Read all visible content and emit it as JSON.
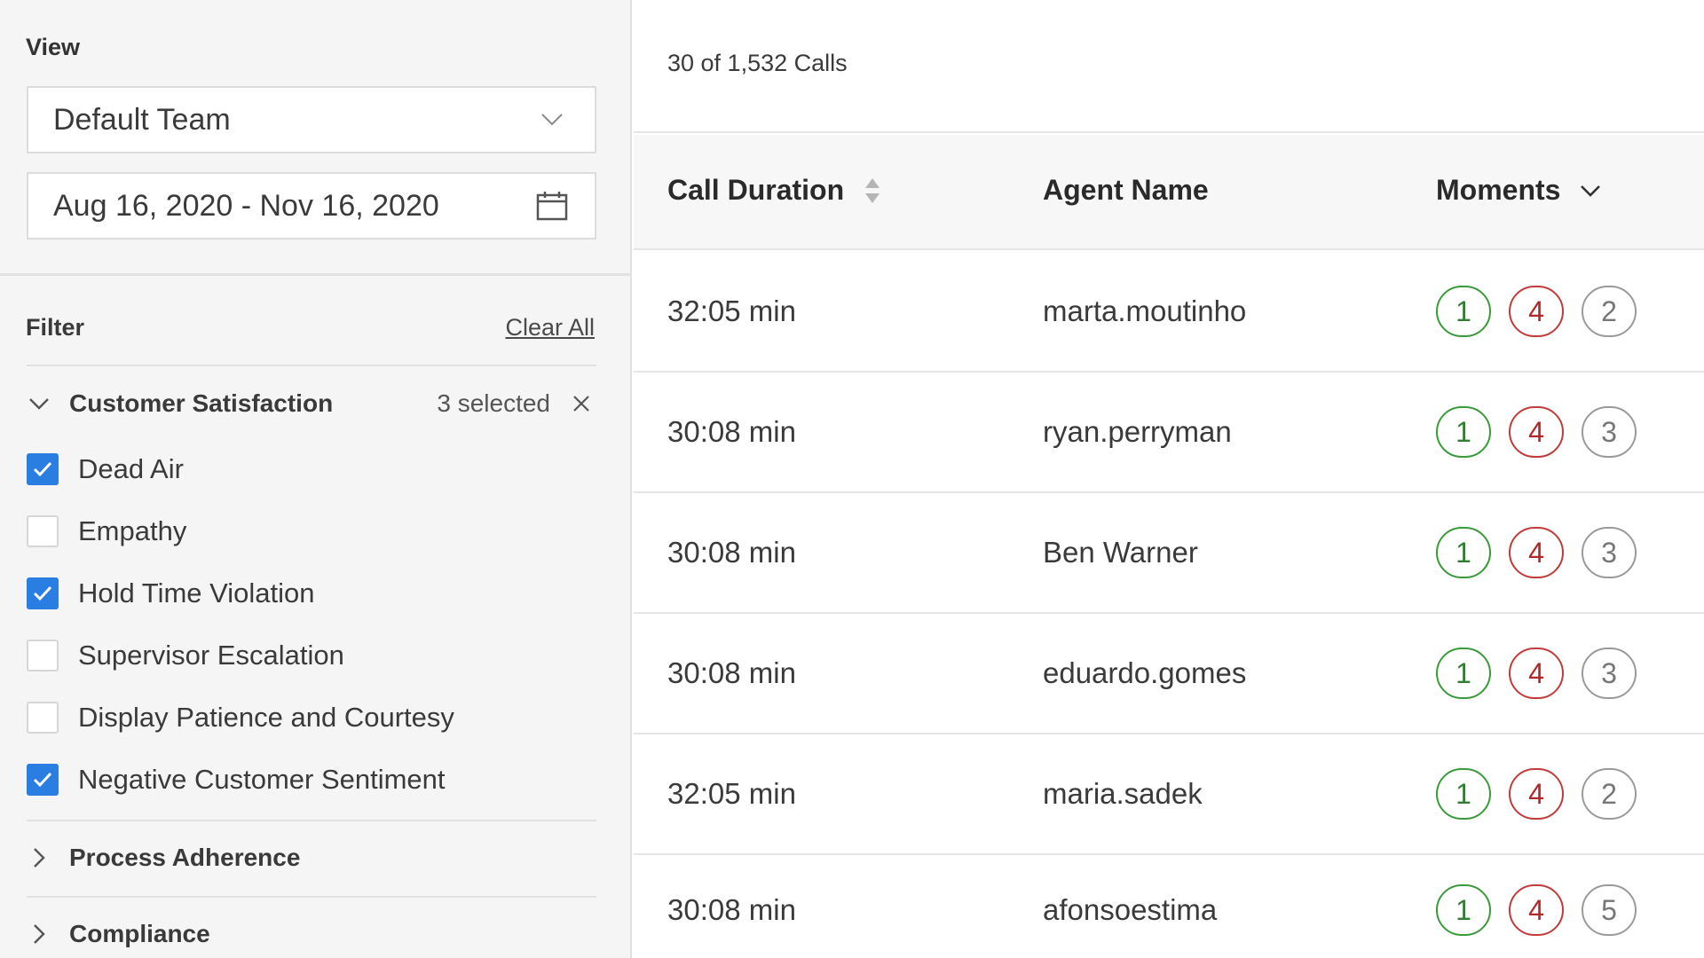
{
  "left": {
    "view_label": "View",
    "team_select": {
      "value": "Default Team",
      "icon": "chevron-down-icon"
    },
    "date_range": {
      "value": "Aug 16, 2020 - Nov 16, 2020",
      "icon": "calendar-icon"
    },
    "filter_label": "Filter",
    "clear_all": "Clear All",
    "groups": [
      {
        "title": "Customer Satisfaction",
        "expanded": true,
        "selected_text": "3 selected",
        "options": [
          {
            "label": "Dead Air",
            "checked": true
          },
          {
            "label": "Empathy",
            "checked": false
          },
          {
            "label": "Hold Time Violation",
            "checked": true
          },
          {
            "label": "Supervisor Escalation",
            "checked": false
          },
          {
            "label": "Display Patience and Courtesy",
            "checked": false
          },
          {
            "label": "Negative Customer Sentiment",
            "checked": true
          }
        ]
      },
      {
        "title": "Process Adherence",
        "expanded": false
      },
      {
        "title": "Compliance",
        "expanded": false
      }
    ]
  },
  "right": {
    "count_text": "30 of 1,532 Calls",
    "columns": [
      "Call Duration",
      "Agent Name",
      "Moments"
    ],
    "rows": [
      {
        "duration": "32:05 min",
        "agent": "marta.moutinho",
        "moments": [
          "1",
          "4",
          "2"
        ]
      },
      {
        "duration": "30:08 min",
        "agent": "ryan.perryman",
        "moments": [
          "1",
          "4",
          "3"
        ]
      },
      {
        "duration": "30:08 min",
        "agent": "Ben Warner",
        "moments": [
          "1",
          "4",
          "3"
        ]
      },
      {
        "duration": "30:08 min",
        "agent": "eduardo.gomes",
        "moments": [
          "1",
          "4",
          "3"
        ]
      },
      {
        "duration": "32:05 min",
        "agent": "maria.sadek",
        "moments": [
          "1",
          "4",
          "2"
        ]
      },
      {
        "duration": "30:08 min",
        "agent": "afonsoestima",
        "moments": [
          "1",
          "4",
          "5"
        ]
      }
    ]
  },
  "colors": {
    "checkbox_accent": "#2a7de1",
    "moment_positive": "#3a9a3a",
    "moment_negative": "#c23b3b",
    "moment_neutral": "#9a9a9a"
  }
}
